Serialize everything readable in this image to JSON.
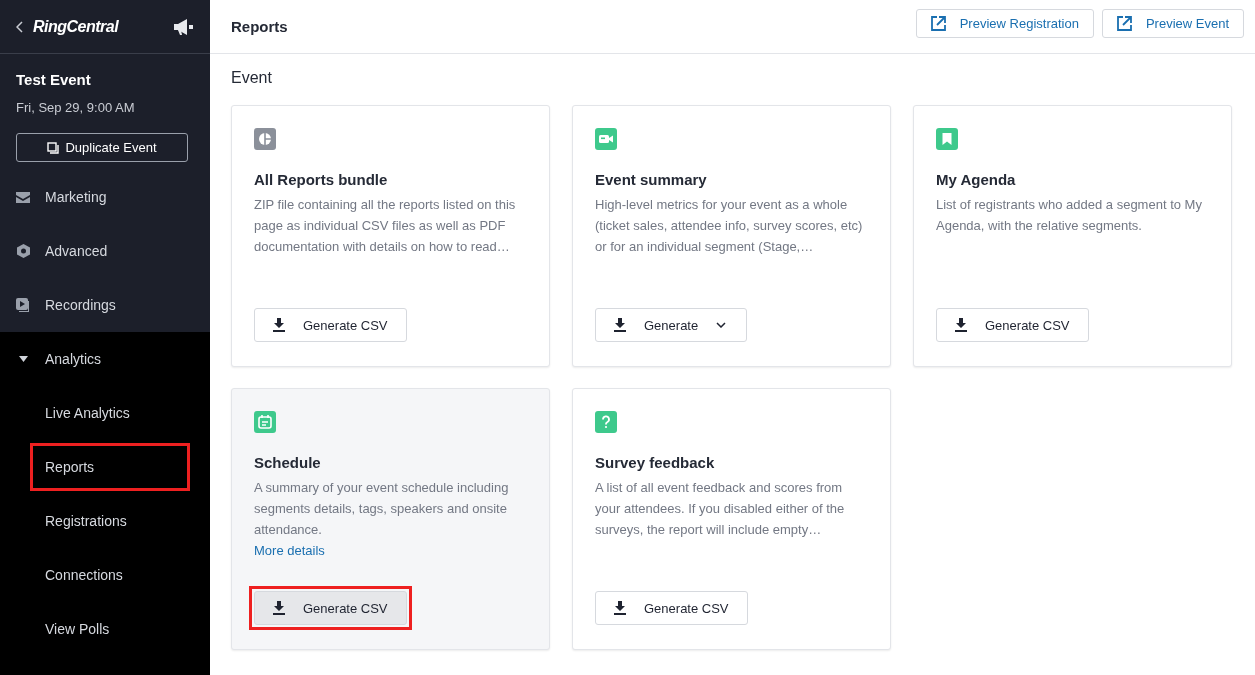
{
  "sidebar": {
    "logo": "RingCentral",
    "event_title": "Test Event",
    "event_date": "Fri, Sep 29, 9:00 AM",
    "duplicate_button": "Duplicate Event",
    "items": [
      {
        "label": "Marketing"
      },
      {
        "label": "Advanced"
      },
      {
        "label": "Recordings"
      },
      {
        "label": "Analytics",
        "expanded": true,
        "children": [
          {
            "label": "Live Analytics",
            "highlighted": false
          },
          {
            "label": "Reports",
            "highlighted": true
          },
          {
            "label": "Registrations",
            "highlighted": false
          },
          {
            "label": "Connections",
            "highlighted": false
          },
          {
            "label": "View Polls",
            "highlighted": false
          }
        ]
      }
    ]
  },
  "header": {
    "title": "Reports",
    "buttons": [
      "Preview Registration",
      "Preview Event"
    ]
  },
  "section_title": "Event",
  "cards": [
    {
      "title": "All Reports bundle",
      "description": "ZIP file containing all the reports listed on this page as individual CSV files as well as PDF documentation with details on how to read…",
      "hovered": false,
      "button": {
        "label": "Generate CSV",
        "dropdown": false,
        "highlighted": false
      }
    },
    {
      "title": "Event summary",
      "description": "High-level metrics for your event as a whole (ticket sales, attendee info, survey scores, etc) or for an individual segment (Stage,…",
      "hovered": false,
      "button": {
        "label": "Generate",
        "dropdown": true,
        "highlighted": false
      }
    },
    {
      "title": "My Agenda",
      "description": "List of registrants who added a segment to My Agenda, with the relative segments.",
      "hovered": false,
      "button": {
        "label": "Generate CSV",
        "dropdown": false,
        "highlighted": false
      }
    },
    {
      "title": "Schedule",
      "description": "A summary of your event schedule including segments details, tags, speakers and onsite attendance.",
      "link": "More details",
      "hovered": true,
      "button": {
        "label": "Generate CSV",
        "dropdown": false,
        "highlighted": true
      }
    },
    {
      "title": "Survey feedback",
      "description": "A list of all event feedback and scores from your attendees. If you disabled either of the surveys, the report will include empty…",
      "hovered": false,
      "button": {
        "label": "Generate CSV",
        "dropdown": false,
        "highlighted": false
      }
    }
  ]
}
